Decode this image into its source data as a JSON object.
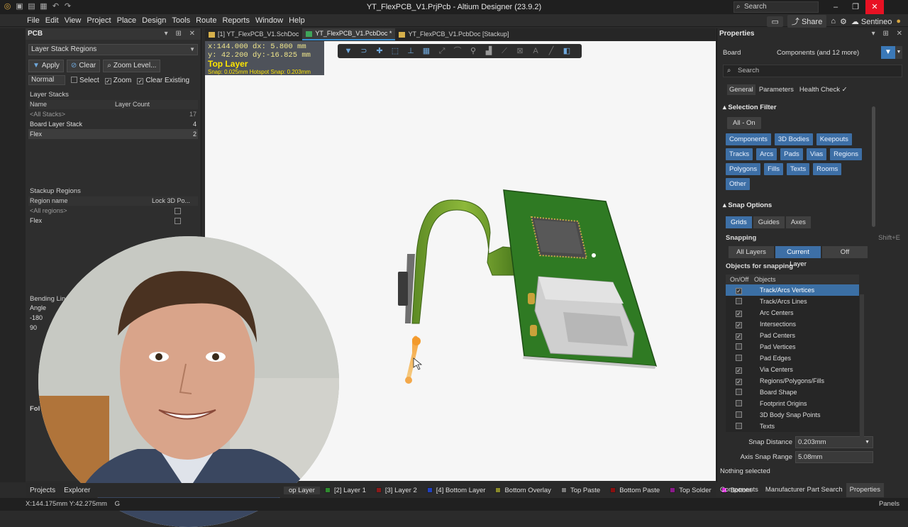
{
  "window": {
    "title": "YT_FlexPCB_V1.PrjPcb - Altium Designer (23.9.2)",
    "search_placeholder": "Search",
    "share": "Share",
    "user": "Sentineo"
  },
  "menu": [
    "File",
    "Edit",
    "View",
    "Project",
    "Place",
    "Design",
    "Tools",
    "Route",
    "Reports",
    "Window",
    "Help"
  ],
  "pcb_panel": {
    "title": "PCB",
    "mode": "Layer Stack Regions",
    "apply": "Apply",
    "clear": "Clear",
    "zoom_level": "Zoom Level...",
    "normal": "Normal",
    "select": "Select",
    "zoom": "Zoom",
    "clear_existing": "Clear Existing",
    "layer_stacks_title": "Layer Stacks",
    "col_name": "Name",
    "col_count": "Layer Count",
    "stacks": [
      {
        "name": "<All Stacks>",
        "count": "17"
      },
      {
        "name": "Board Layer Stack",
        "count": "4"
      },
      {
        "name": "Flex",
        "count": "2"
      }
    ],
    "regions_title": "Stackup Regions",
    "col_region": "Region name",
    "col_lock": "Lock 3D Po...",
    "regions": [
      "<All regions>",
      "Flex"
    ],
    "bending_title": "Bending Lines",
    "angle_label": "Angle",
    "angles": [
      "-180",
      "90"
    ],
    "folding_title": "Fol"
  },
  "tabs": [
    {
      "label": "[1] YT_FlexPCB_V1.SchDoc"
    },
    {
      "label": "YT_FlexPCB_V1.PcbDoc *"
    },
    {
      "label": "YT_FlexPCB_V1.PcbDoc [Stackup]"
    }
  ],
  "hud": {
    "line1": "x:144.000   dx:  5.800  mm",
    "line2": "y: 42.200   dy:-16.825 mm",
    "layer": "Top Layer",
    "snap": "Snap: 0.025mm Hotspot Snap: 0.203mm"
  },
  "bottom_panels": [
    "Projects",
    "Explorer"
  ],
  "layers": [
    {
      "label": "op Layer",
      "color": "#c00000"
    },
    {
      "label": "[2] Layer 1",
      "color": "#2e8b2e"
    },
    {
      "label": "[3] Layer 2",
      "color": "#8b1a1a"
    },
    {
      "label": "[4] Bottom Layer",
      "color": "#2040c0"
    },
    {
      "label": "Bottom Overlay",
      "color": "#8a8a2a"
    },
    {
      "label": "Top Paste",
      "color": "#7a7a7a"
    },
    {
      "label": "Bottom Paste",
      "color": "#8b1010"
    },
    {
      "label": "Top Solder",
      "color": "#8b1a8b"
    },
    {
      "label": "Bottom",
      "color": "#e020e0"
    }
  ],
  "status": {
    "coords": "X:144.175mm Y:42.275mm",
    "grid_prefix": "G",
    "panels": "Panels"
  },
  "properties": {
    "title": "Properties",
    "board": "Board",
    "components": "Components (and 12 more)",
    "search": "Search",
    "tabs": [
      "General",
      "Parameters",
      "Health Check"
    ],
    "selection_filter": "Selection Filter",
    "all_on": "All - On",
    "filters": [
      "Components",
      "3D Bodies",
      "Keepouts",
      "Tracks",
      "Arcs",
      "Pads",
      "Vias",
      "Regions",
      "Polygons",
      "Fills",
      "Texts",
      "Rooms",
      "Other"
    ],
    "snap_options": "Snap Options",
    "snap_modes": [
      "Grids",
      "Guides",
      "Axes"
    ],
    "snapping": "Snapping",
    "snapping_shortcut": "Shift+E",
    "snap_layers": [
      "All Layers",
      "Current Layer",
      "Off"
    ],
    "objects_for_snapping": "Objects for snapping",
    "col_onoff": "On/Off",
    "col_objects": "Objects",
    "snap_objects": [
      {
        "name": "Track/Arcs Vertices",
        "on": true
      },
      {
        "name": "Track/Arcs Lines",
        "on": false
      },
      {
        "name": "Arc Centers",
        "on": true
      },
      {
        "name": "Intersections",
        "on": true
      },
      {
        "name": "Pad Centers",
        "on": true
      },
      {
        "name": "Pad Vertices",
        "on": false
      },
      {
        "name": "Pad Edges",
        "on": false
      },
      {
        "name": "Via Centers",
        "on": true
      },
      {
        "name": "Regions/Polygons/Fills",
        "on": true
      },
      {
        "name": "Board Shape",
        "on": false
      },
      {
        "name": "Footprint Origins",
        "on": false
      },
      {
        "name": "3D Body Snap Points",
        "on": false
      },
      {
        "name": "Texts",
        "on": false
      }
    ],
    "snap_distance_label": "Snap Distance",
    "snap_distance": "0.203mm",
    "axis_snap_label": "Axis Snap Range",
    "axis_snap": "5.08mm",
    "nothing_selected": "Nothing selected"
  },
  "right_bottom": [
    "Components",
    "Manufacturer Part Search",
    "Properties"
  ]
}
